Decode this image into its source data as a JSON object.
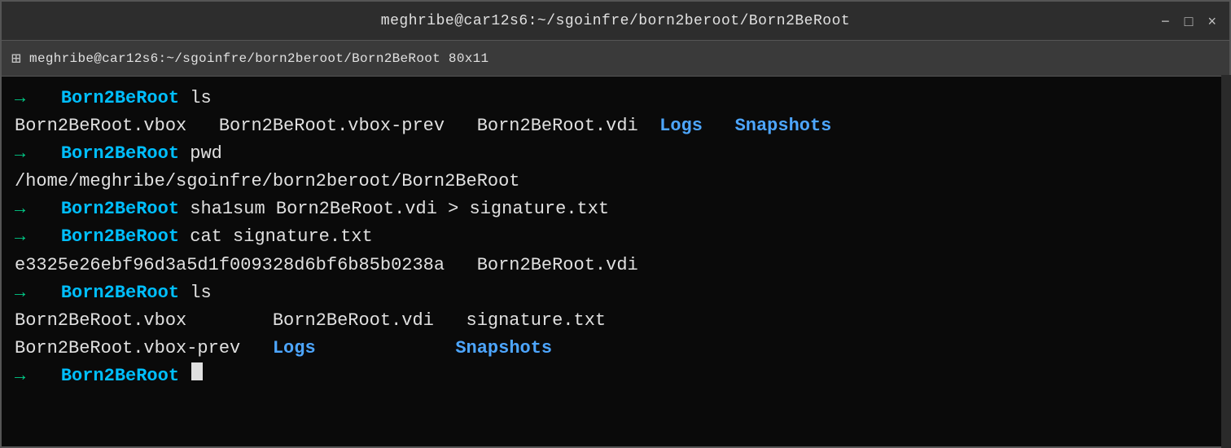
{
  "window": {
    "title": "meghribe@car12s6:~/sgoinfre/born2beroot/Born2BeRoot",
    "tab_title": "meghribe@car12s6:~/sgoinfre/born2beroot/Born2BeRoot 80x11",
    "controls": {
      "minimize": "−",
      "maximize": "□",
      "close": "×"
    }
  },
  "terminal": {
    "lines": [
      {
        "type": "prompt",
        "arrow": "→",
        "dir": "Born2BeRoot",
        "cmd": " ls"
      },
      {
        "type": "output_mixed",
        "parts": [
          {
            "text": "Born2BeRoot.vbox   Born2BeRoot.vbox-prev   Born2BeRoot.vdi  ",
            "color": "normal"
          },
          {
            "text": "Logs",
            "color": "blue"
          },
          {
            "text": "   ",
            "color": "normal"
          },
          {
            "text": "Snapshots",
            "color": "blue"
          }
        ]
      },
      {
        "type": "prompt",
        "arrow": "→",
        "dir": "Born2BeRoot",
        "cmd": " pwd"
      },
      {
        "type": "output",
        "text": "/home/meghribe/sgoinfre/born2beroot/Born2BeRoot"
      },
      {
        "type": "prompt",
        "arrow": "→",
        "dir": "Born2BeRoot",
        "cmd": " sha1sum Born2BeRoot.vdi > signature.txt"
      },
      {
        "type": "prompt",
        "arrow": "→",
        "dir": "Born2BeRoot",
        "cmd": " cat signature.txt"
      },
      {
        "type": "output",
        "text": "e3325e26ebf96d3a5d1f009328d6bf6b85b0238a   Born2BeRoot.vdi"
      },
      {
        "type": "prompt",
        "arrow": "→",
        "dir": "Born2BeRoot",
        "cmd": " ls"
      },
      {
        "type": "output_mixed",
        "parts": [
          {
            "text": "Born2BeRoot.vbox        Born2BeRoot.vdi   signature.txt",
            "color": "normal"
          }
        ]
      },
      {
        "type": "output_mixed",
        "parts": [
          {
            "text": "Born2BeRoot.vbox-prev   ",
            "color": "normal"
          },
          {
            "text": "Logs",
            "color": "blue"
          },
          {
            "text": "             ",
            "color": "normal"
          },
          {
            "text": "Snapshots",
            "color": "blue"
          }
        ]
      },
      {
        "type": "prompt_cursor",
        "arrow": "→",
        "dir": "Born2BeRoot",
        "cmd": " "
      }
    ]
  }
}
